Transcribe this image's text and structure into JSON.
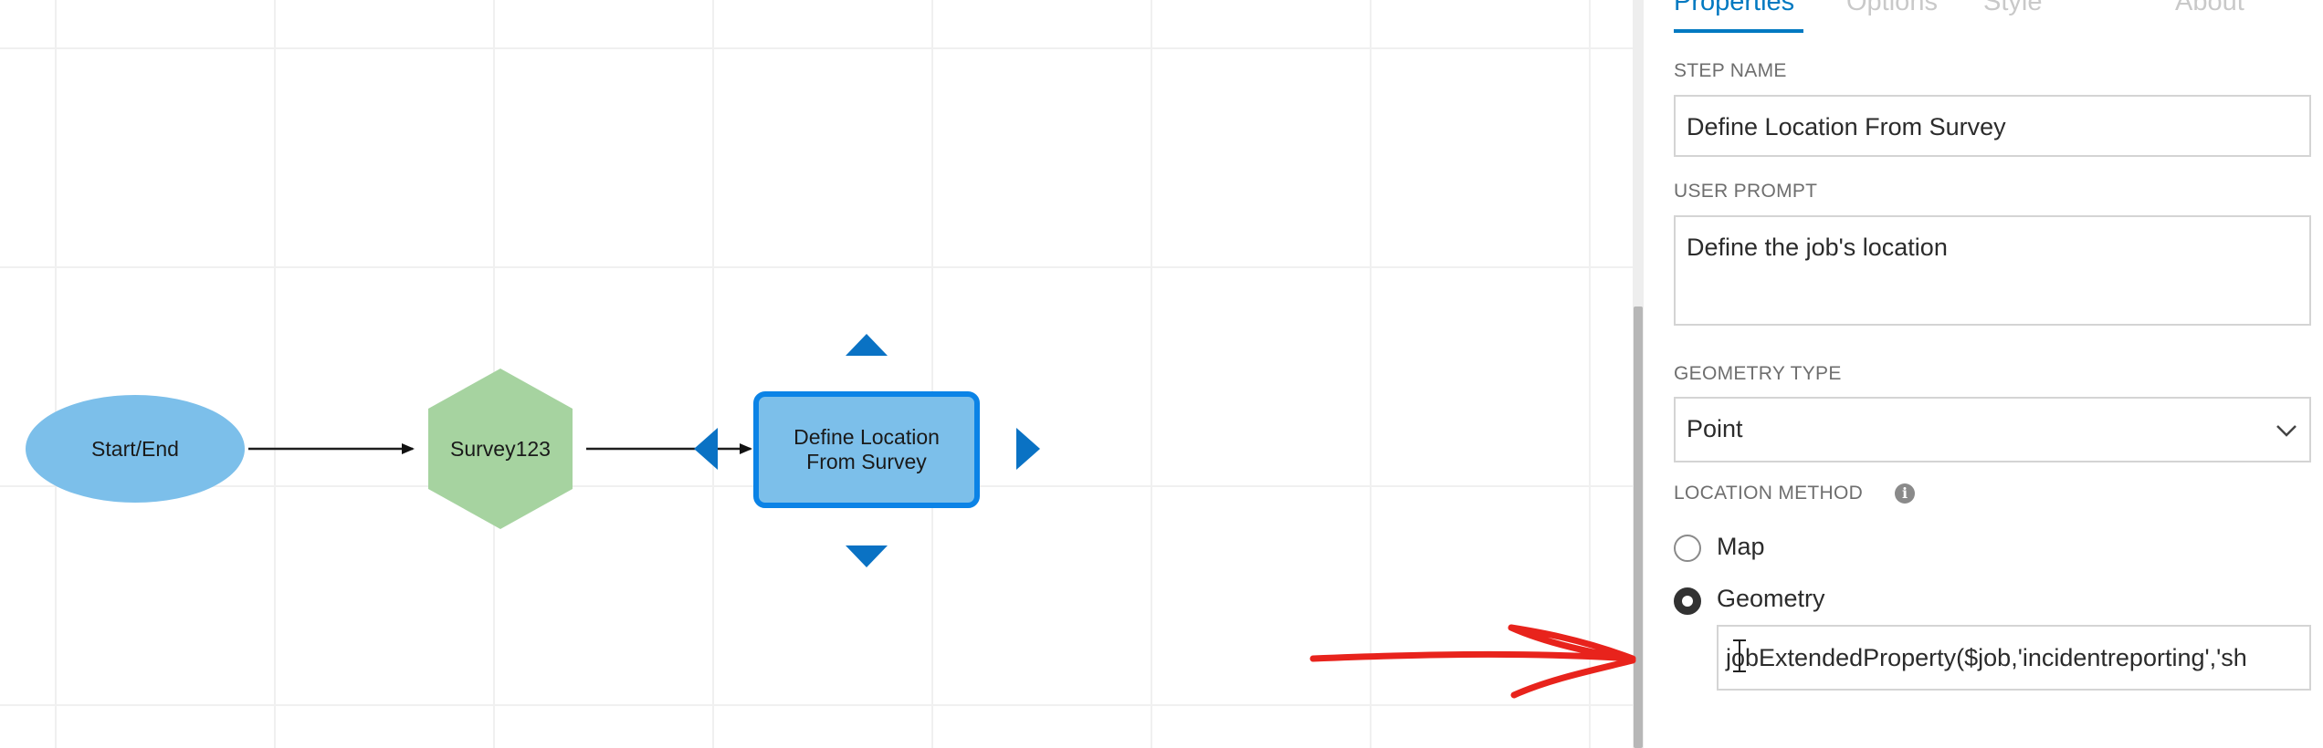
{
  "tabs": [
    {
      "label": "Properties",
      "active": true
    },
    {
      "label": "Options",
      "active": false
    },
    {
      "label": "Style",
      "active": false
    },
    {
      "label": "About",
      "active": false
    }
  ],
  "step_name": {
    "label": "STEP NAME",
    "value": "Define Location From Survey"
  },
  "user_prompt": {
    "label": "USER PROMPT",
    "value": "Define the job's location"
  },
  "geometry_type": {
    "label": "GEOMETRY TYPE",
    "value": "Point"
  },
  "location_method": {
    "label": "LOCATION METHOD",
    "options": [
      {
        "label": "Map",
        "checked": false
      },
      {
        "label": "Geometry",
        "checked": true
      }
    ],
    "expression": "jobExtendedProperty($job,'incidentreporting','sh"
  },
  "diagram": {
    "nodes": [
      {
        "label": "Start/End",
        "shape": "ellipse",
        "color": "#7cbfea"
      },
      {
        "label": "Survey123",
        "shape": "hexagon",
        "color": "#a6d3a0"
      },
      {
        "label_line1": "Define Location",
        "label_line2": "From Survey",
        "shape": "rectangle",
        "color": "#7cbfea",
        "selected": true
      }
    ],
    "accent_color": "#0079c1"
  },
  "annotation": {
    "color": "#e8231c",
    "icon": "red-arrow"
  }
}
